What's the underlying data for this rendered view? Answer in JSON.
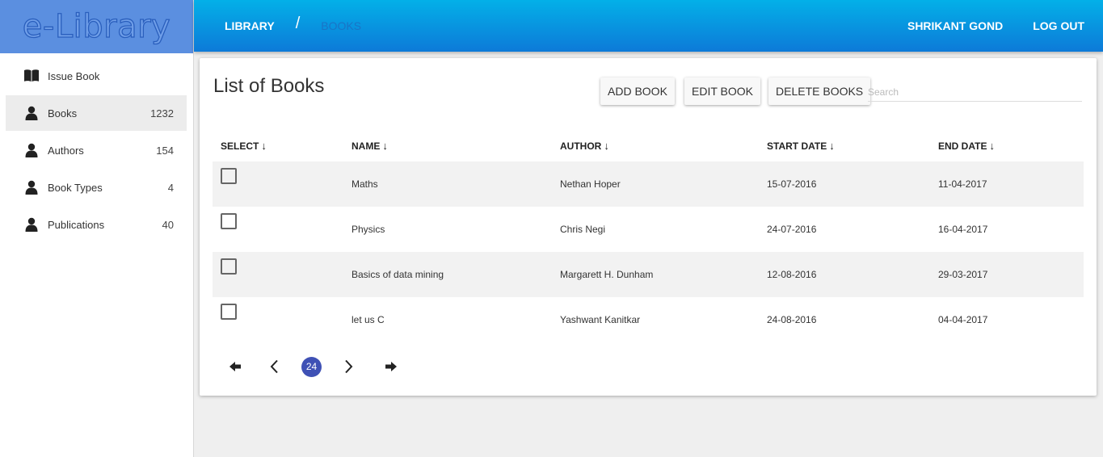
{
  "app": {
    "logo": "e-Library"
  },
  "sidebar": {
    "items": [
      {
        "label": "Issue Book",
        "count": "",
        "icon": "book-icon"
      },
      {
        "label": "Books",
        "count": "1232",
        "icon": "person-icon"
      },
      {
        "label": "Authors",
        "count": "154",
        "icon": "person-icon"
      },
      {
        "label": "Book Types",
        "count": "4",
        "icon": "person-icon"
      },
      {
        "label": "Publications",
        "count": "40",
        "icon": "person-icon"
      }
    ],
    "active_index": 1
  },
  "header": {
    "breadcrumb": [
      "LIBRARY",
      "BOOKS"
    ],
    "separator": "/",
    "user": "SHRIKANT GOND",
    "logout": "LOG OUT"
  },
  "main": {
    "title": "List of Books",
    "buttons": {
      "add": "ADD BOOK",
      "edit": "EDIT BOOK",
      "delete": "DELETE BOOKS"
    },
    "search": {
      "placeholder": "Search",
      "value": ""
    },
    "table": {
      "columns": [
        "SELECT",
        "NAME",
        "AUTHOR",
        "START DATE",
        "END DATE"
      ],
      "sort_arrow": "↓",
      "rows": [
        {
          "name": "Maths",
          "author": "Nethan Hoper",
          "start": "15-07-2016",
          "end": "11-04-2017"
        },
        {
          "name": "Physics",
          "author": "Chris Negi",
          "start": "24-07-2016",
          "end": "16-04-2017"
        },
        {
          "name": "Basics of data mining",
          "author": "Margarett H. Dunham",
          "start": "12-08-2016",
          "end": "29-03-2017"
        },
        {
          "name": "let us C",
          "author": "Yashwant Kanitkar",
          "start": "24-08-2016",
          "end": "04-04-2017"
        }
      ]
    },
    "pagination": {
      "current_page": "24"
    }
  },
  "colors": {
    "header_gradient_top": "#03b0e8",
    "header_gradient_bottom": "#0d7ad8",
    "logo_bg": "#5b8fe0",
    "page_badge": "#3f51b5"
  }
}
